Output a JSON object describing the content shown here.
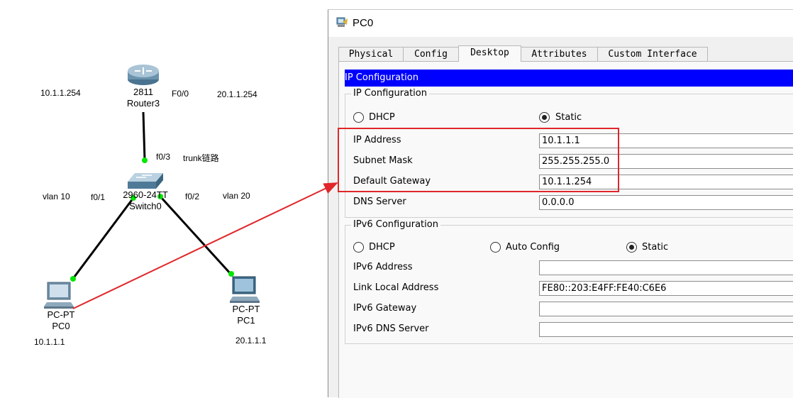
{
  "topology": {
    "router": {
      "model": "2811",
      "name": "Router3"
    },
    "switch": {
      "model": "2960-24TT",
      "name": "Switch0"
    },
    "pc0": {
      "model": "PC-PT",
      "name": "PC0",
      "ip": "10.1.1.1"
    },
    "pc1": {
      "model": "PC-PT",
      "name": "PC1",
      "ip": "20.1.1.1"
    },
    "labels": {
      "left_subnet": "10.1.1.254",
      "router_port": "F0/0",
      "right_subnet": "20.1.1.254",
      "switch_uplink_port": "f0/3",
      "trunk": "trunk链路",
      "vlan_left": "vlan 10",
      "port_left": "f0/1",
      "port_right": "f0/2",
      "vlan_right": "vlan 20"
    },
    "colors": {
      "link": "#000000",
      "port_dot": "#00e600",
      "annotation": "#e0262a"
    }
  },
  "window": {
    "title": "PC0",
    "tabs": [
      "Physical",
      "Config",
      "Desktop",
      "Attributes",
      "Custom Interface"
    ],
    "active_tab": "Desktop",
    "banner": "IP Configuration",
    "ipv4": {
      "group_title": "IP Configuration",
      "dhcp_label": "DHCP",
      "static_label": "Static",
      "selected": "Static",
      "fields": [
        {
          "label": "IP Address",
          "value": "10.1.1.1"
        },
        {
          "label": "Subnet Mask",
          "value": "255.255.255.0"
        },
        {
          "label": "Default Gateway",
          "value": "10.1.1.254"
        },
        {
          "label": "DNS Server",
          "value": "0.0.0.0"
        }
      ]
    },
    "ipv6": {
      "group_title": "IPv6 Configuration",
      "dhcp_label": "DHCP",
      "auto_label": "Auto Config",
      "static_label": "Static",
      "selected": "Static",
      "fields": [
        {
          "label": "IPv6 Address",
          "value": ""
        },
        {
          "label": "Link Local Address",
          "value": "FE80::203:E4FF:FE40:C6E6"
        },
        {
          "label": "IPv6 Gateway",
          "value": ""
        },
        {
          "label": "IPv6 DNS Server",
          "value": ""
        }
      ]
    }
  }
}
